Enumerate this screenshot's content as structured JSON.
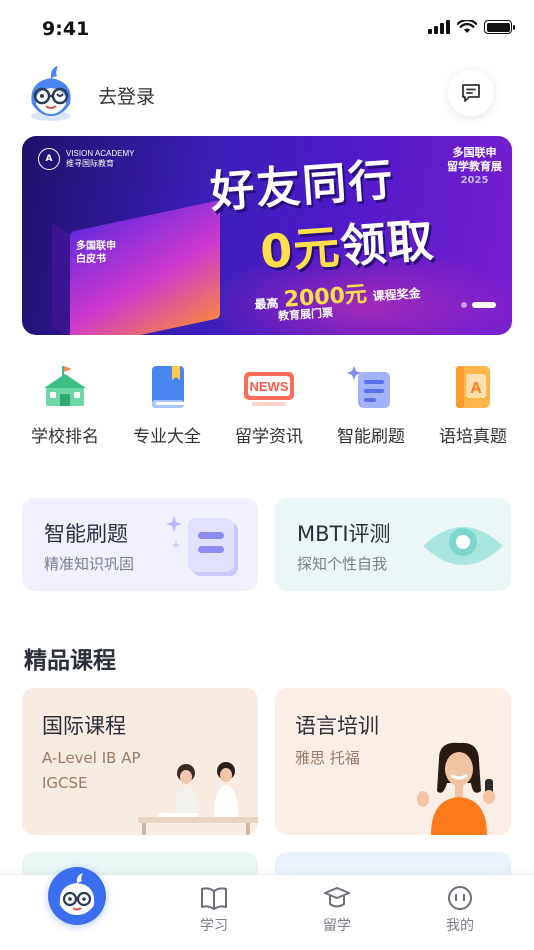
{
  "status_bar": {
    "time": "9:41"
  },
  "header": {
    "login_text": "去登录"
  },
  "banner": {
    "brand_line1": "VISION ACADEMY",
    "brand_line2": "维寻国际教育",
    "headline_line1": "好友同行",
    "headline_zero": "0元",
    "headline_line2": "领取",
    "sub_prefix": "最高",
    "sub_amount": "2000元",
    "sub_suffix": "课程奖金",
    "sub_line2": "教育展门票",
    "card_title": "多国联申白皮书",
    "tag_line1": "多国联申",
    "tag_line2": "留学教育展",
    "tag_year": "2025"
  },
  "quick_nav": [
    {
      "label": "学校排名",
      "icon": "school-icon"
    },
    {
      "label": "专业大全",
      "icon": "book-icon"
    },
    {
      "label": "留学资讯",
      "icon": "news-icon",
      "badge": "NEWS"
    },
    {
      "label": "智能刷题",
      "icon": "practice-icon"
    },
    {
      "label": "语培真题",
      "icon": "language-exam-icon",
      "badge": "A"
    }
  ],
  "features": [
    {
      "title": "智能刷题",
      "subtitle": "精准知识巩固"
    },
    {
      "title": "MBTI评测",
      "subtitle": "探知个性自我"
    }
  ],
  "section": {
    "title": "精品课程"
  },
  "courses": [
    {
      "title": "国际课程",
      "subtitle": "A-Level IB AP IGCSE"
    },
    {
      "title": "语言培训",
      "subtitle": "雅思 托福"
    }
  ],
  "tabbar": {
    "tabs": [
      {
        "label": "学习"
      },
      {
        "label": "留学"
      },
      {
        "label": "我的"
      }
    ]
  },
  "colors": {
    "accent": "#3b6ff0",
    "banner_start": "#20106a",
    "banner_end": "#7a1fd0",
    "feature_purple": "#f1f0fd",
    "feature_teal": "#eaf7f6",
    "course_peach": "#f8ebe1"
  }
}
